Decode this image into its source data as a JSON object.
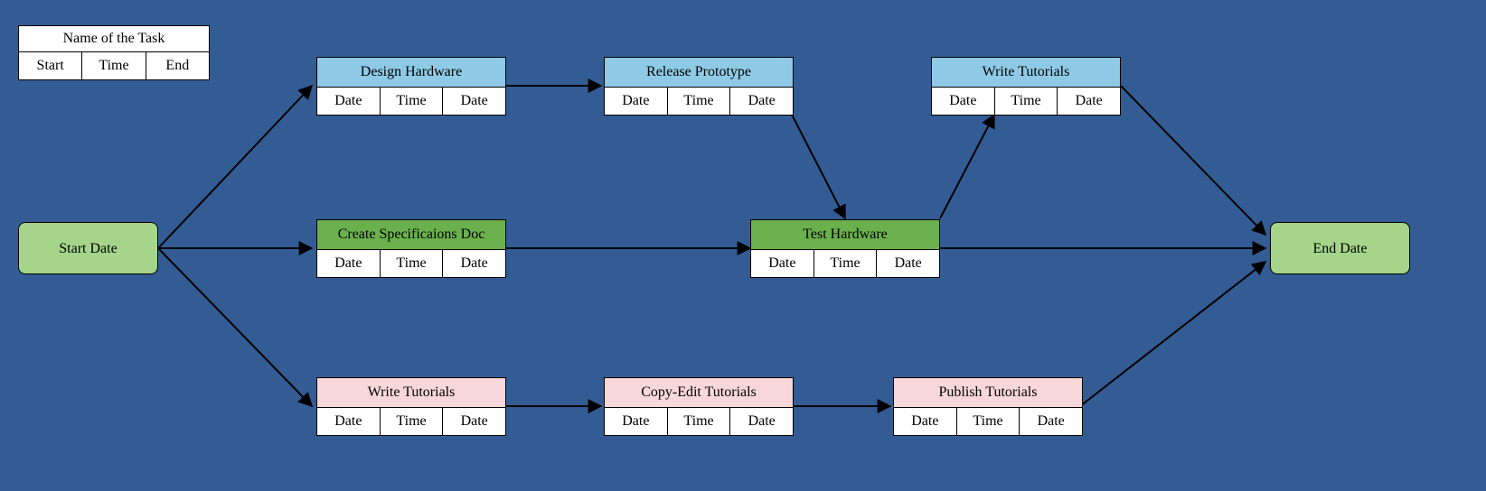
{
  "legend": {
    "title": "Name of the Task",
    "start": "Start",
    "time": "Time",
    "end": "End"
  },
  "endpoints": {
    "start": "Start Date",
    "end": "End Date"
  },
  "default_cells": {
    "start": "Date",
    "time": "Time",
    "end": "Date"
  },
  "tasks": {
    "design_hardware": {
      "title": "Design Hardware"
    },
    "release_prototype": {
      "title": "Release Prototype"
    },
    "write_tutorials_top": {
      "title": "Write Tutorials"
    },
    "create_spec": {
      "title": "Create Specificaions Doc"
    },
    "test_hardware": {
      "title": "Test Hardware"
    },
    "write_tutorials_bot": {
      "title": "Write Tutorials"
    },
    "copy_edit": {
      "title": "Copy-Edit Tutorials"
    },
    "publish_tutorials": {
      "title": "Publish Tutorials"
    }
  },
  "colors": {
    "blue": "#8ecae6",
    "green": "#6ab04c",
    "pink": "#f8d7da",
    "pill": "#a4d58a",
    "bg": "#335c94"
  }
}
